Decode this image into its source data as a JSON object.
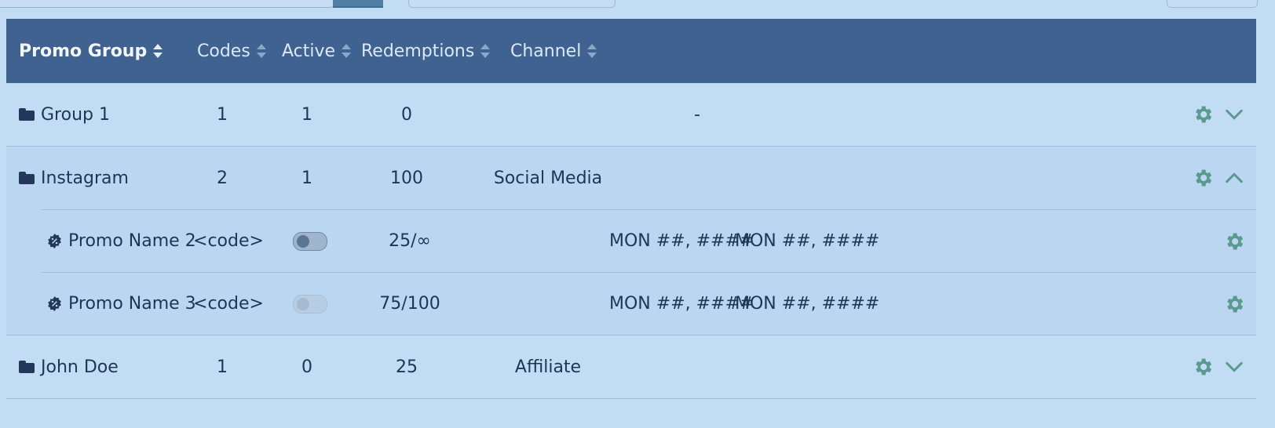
{
  "table": {
    "headers": {
      "promo_group": "Promo Group",
      "codes": "Codes",
      "active": "Active",
      "redemptions": "Redemptions",
      "channel": "Channel"
    },
    "groups": [
      {
        "name": "Group 1",
        "codes": "1",
        "active": "1",
        "redemptions": "0",
        "channel": "-",
        "state": "collapsed"
      },
      {
        "name": "Instagram",
        "codes": "2",
        "active": "1",
        "redemptions": "100",
        "channel": "Social Media",
        "state": "expanded"
      },
      {
        "name": "John Doe",
        "codes": "1",
        "active": "0",
        "redemptions": "25",
        "channel": "Affiliate",
        "state": "collapsed"
      }
    ],
    "promos": [
      {
        "name": "Promo Name 2",
        "code": "<code>",
        "toggle_on": false,
        "toggle_enabled": true,
        "redemptions": "25/∞",
        "start": "MON ##, ####",
        "end": "MON ##, ####"
      },
      {
        "name": "Promo Name 3",
        "code": "<code>",
        "toggle_on": false,
        "toggle_enabled": false,
        "redemptions": "75/100",
        "start": "MON ##, ####",
        "end": "MON ##, ####"
      }
    ]
  },
  "colors": {
    "background": "#c2dcf4",
    "header": "#3f6290",
    "icon_green": "#5a9a8f",
    "text": "#1e3556"
  },
  "icons": {
    "group": "folder-icon",
    "promo": "percent-badge-icon",
    "settings": "gear-icon",
    "expand": "chevron-down-icon",
    "collapse": "chevron-up-icon",
    "sort": "sort-icon"
  }
}
